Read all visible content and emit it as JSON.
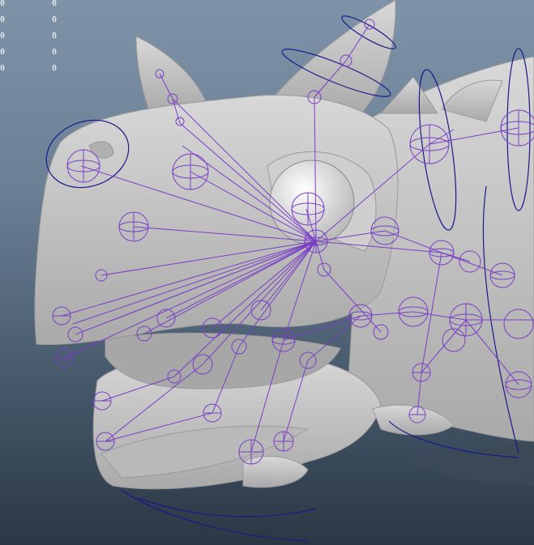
{
  "viewport": {
    "hud_rows": [
      {
        "a": "0",
        "b": "0"
      },
      {
        "a": "0",
        "b": "0"
      },
      {
        "a": "0",
        "b": "0"
      },
      {
        "a": "0",
        "b": "0"
      },
      {
        "a": "0",
        "b": "0"
      }
    ],
    "colors": {
      "background_top": "#7f93a8",
      "background_bottom": "#2b3744",
      "mesh": "#c4c4c4",
      "joint_wire": "#7a3fc6",
      "control_curve": "#1a1a88"
    }
  }
}
